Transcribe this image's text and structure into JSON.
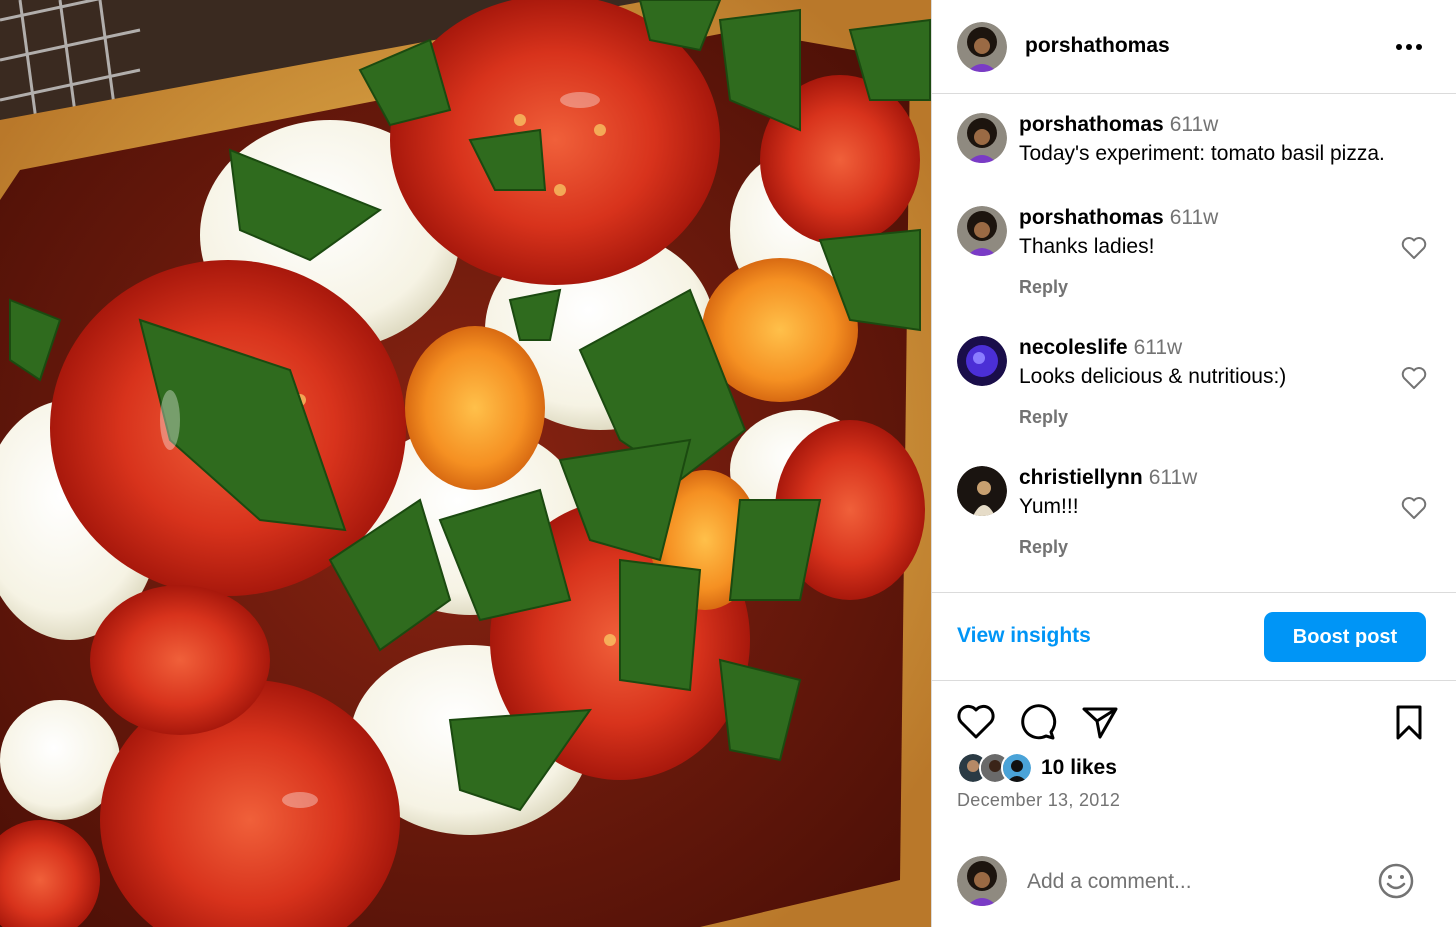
{
  "post": {
    "author": "porshathomas",
    "photo_description_icon": "pizza-photo"
  },
  "header": {
    "username": "porshathomas",
    "more_icon": "more-horizontal-icon"
  },
  "comments": [
    {
      "username": "porshathomas",
      "time": "611w",
      "text": "Today's experiment: tomato basil pizza.",
      "has_reply": false
    },
    {
      "username": "porshathomas",
      "time": "611w",
      "text": "Thanks ladies!",
      "reply_label": "Reply",
      "has_reply": true
    },
    {
      "username": "necoleslife",
      "time": "611w",
      "text": "Looks delicious & nutritious:)",
      "reply_label": "Reply",
      "has_reply": true
    },
    {
      "username": "christiellynn",
      "time": "611w",
      "text": "Yum!!!",
      "reply_label": "Reply",
      "has_reply": true
    }
  ],
  "actions": {
    "view_insights": "View insights",
    "boost_post": "Boost post"
  },
  "engagement": {
    "likes": "10 likes",
    "date": "December 13, 2012"
  },
  "composer": {
    "placeholder": "Add a comment..."
  },
  "colors": {
    "accent": "#0095f6",
    "muted": "#737373",
    "divider": "#dbdbdb"
  }
}
